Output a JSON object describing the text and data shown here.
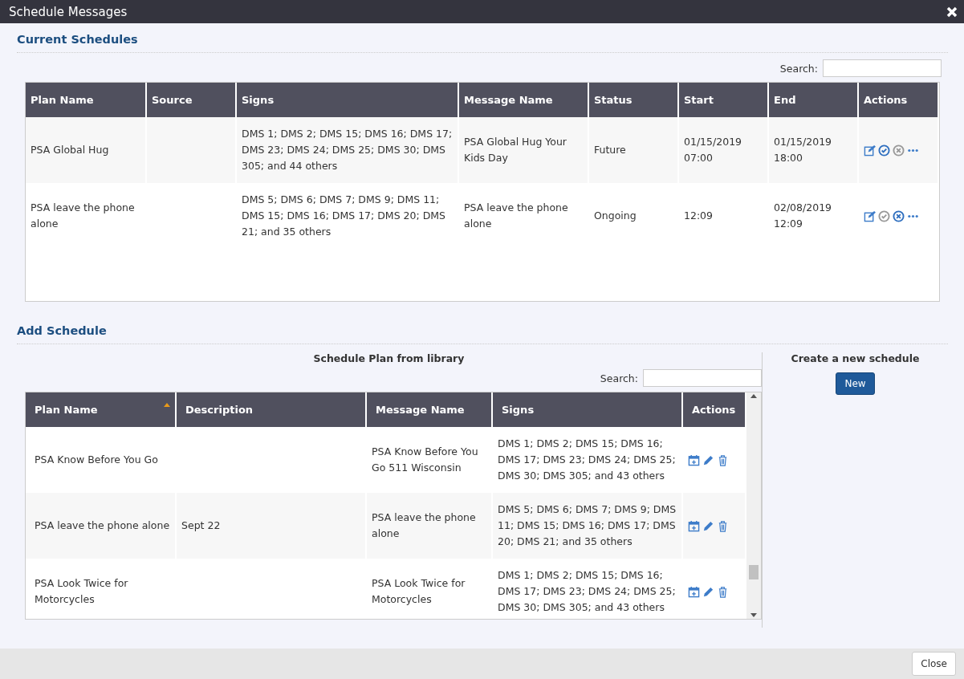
{
  "window": {
    "title": "Schedule Messages"
  },
  "current": {
    "heading": "Current Schedules",
    "search_label": "Search:",
    "columns": [
      "Plan Name",
      "Source",
      "Signs",
      "Message Name",
      "Status",
      "Start",
      "End",
      "Actions"
    ],
    "rows": [
      {
        "plan": "PSA Global Hug",
        "source": "",
        "signs": "DMS 1; DMS 2; DMS 15; DMS 16; DMS 17; DMS 23; DMS 24; DMS 25; DMS 30; DMS 305; and 44 others",
        "message": "PSA Global Hug Your Kids Day",
        "status": "Future",
        "start": "01/15/2019 07:00",
        "end": "01/15/2019 18:00",
        "approve_disabled": false,
        "cancel_disabled": true
      },
      {
        "plan": "PSA leave the phone alone",
        "source": "",
        "signs": "DMS 5; DMS 6; DMS 7; DMS 9; DMS 11; DMS 15; DMS 16; DMS 17; DMS 20; DMS 21; and 35 others",
        "message": "PSA leave the phone alone",
        "status": "Ongoing",
        "start": "12:09",
        "end": "02/08/2019 12:09",
        "approve_disabled": true,
        "cancel_disabled": false
      }
    ]
  },
  "add": {
    "heading": "Add Schedule",
    "library_title": "Schedule Plan from library",
    "search_label": "Search:",
    "columns": [
      {
        "label": "Plan Name",
        "sorted": true
      },
      {
        "label": "Description",
        "sorted": false
      },
      {
        "label": "Message Name",
        "sorted": false
      },
      {
        "label": "Signs",
        "sorted": false
      },
      {
        "label": "Actions",
        "sorted": false
      }
    ],
    "rows": [
      {
        "plan": "PSA Know Before You Go",
        "description": "",
        "message": "PSA Know Before You Go 511 Wisconsin",
        "signs": "DMS 1; DMS 2; DMS 15; DMS 16; DMS 17; DMS 23; DMS 24; DMS 25; DMS 30; DMS 305; and 43 others"
      },
      {
        "plan": "PSA leave the phone alone",
        "description": "Sept 22",
        "message": "PSA leave the phone alone",
        "signs": "DMS 5; DMS 6; DMS 7; DMS 9; DMS 11; DMS 15; DMS 16; DMS 17; DMS 20; DMS 21; and 35 others"
      },
      {
        "plan": "PSA Look Twice for Motorcycles",
        "description": "",
        "message": "PSA Look Twice for Motorcycles",
        "signs": "DMS 1; DMS 2; DMS 15; DMS 16; DMS 17; DMS 23; DMS 24; DMS 25; DMS 30; DMS 305; and 43 others"
      }
    ],
    "new_title": "Create a new schedule",
    "new_button": "New"
  },
  "footer": {
    "close_button": "Close"
  }
}
